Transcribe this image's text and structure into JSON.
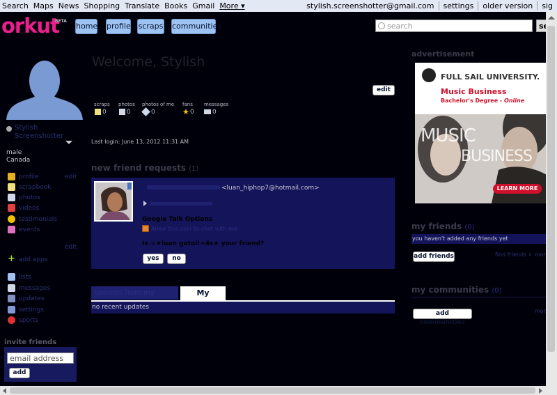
{
  "gbar": {
    "left": [
      "Search",
      "Maps",
      "News",
      "Shopping",
      "Translate",
      "Books",
      "Gmail",
      "More ▾"
    ],
    "email": "stylish.screenshotter@gmail.com",
    "settings": "settings",
    "older": "older version",
    "signout": "sig"
  },
  "header": {
    "logo": "orkut",
    "beta": "BETA",
    "nav": [
      "home",
      "profile",
      "scraps",
      "communities"
    ],
    "search_placeholder": "search",
    "search_button": "sea"
  },
  "profile": {
    "name": "Stylish Screenshotter",
    "gender": "male",
    "country": "Canada",
    "edit1": "edit",
    "edit2": "edit",
    "menu1": [
      "profile",
      "scrapbook",
      "photos",
      "videos",
      "testimonials",
      "events"
    ],
    "add_apps": "add apps",
    "menu2": [
      "lists",
      "messages",
      "updates",
      "settings",
      "sports"
    ],
    "invite_title": "invite friends",
    "invite_placeholder": "email address",
    "invite_button": "add"
  },
  "main": {
    "welcome": "Welcome, Stylish",
    "edit": "edit",
    "stats_labels": [
      "scraps",
      "photos",
      "photos of me",
      "fans",
      "messages"
    ],
    "stats_values": [
      "0",
      "0",
      "0",
      "0",
      "0"
    ],
    "last_login": "Last login: June 13, 2012 11:31 AM",
    "friend_requests_title": "new friend requests",
    "friend_requests_count": "(1)",
    "requester_email": "<luan_hiphop7@hotmail.com>",
    "gtalk_title": "Google Talk Options",
    "gtalk_option": "Allow this user to chat with me",
    "question": "Is ☠★luan gatoi!=4s★ your friend?",
    "yes": "yes",
    "no": "no",
    "tab_friends": "updates from my friends",
    "tab_mine": "My updates",
    "no_updates": "no recent updates"
  },
  "right": {
    "ad_title": "advertisement",
    "ad": {
      "school": "FULL SAIL UNIVERSITY.",
      "program": "Music Business",
      "degree": "Bachelor's Degree - ",
      "online": "Online",
      "big1": "MUSIC",
      "big2": "BUSINESS",
      "cta": "LEARN MORE"
    },
    "friends_title": "my friends",
    "friends_count": "(0)",
    "friends_empty": "you haven't added any friends yet",
    "add_friends": "add friends",
    "find_friends": "find friends »",
    "more1": "more",
    "communities_title": "my communities",
    "communities_count": "(0)",
    "add_communities": "add communities",
    "more2": "more"
  },
  "colors": {
    "page_bg": "#00000a",
    "panel": "#14145a",
    "brand": "#ea1f8c",
    "nav_button": "#9dc3f2"
  }
}
